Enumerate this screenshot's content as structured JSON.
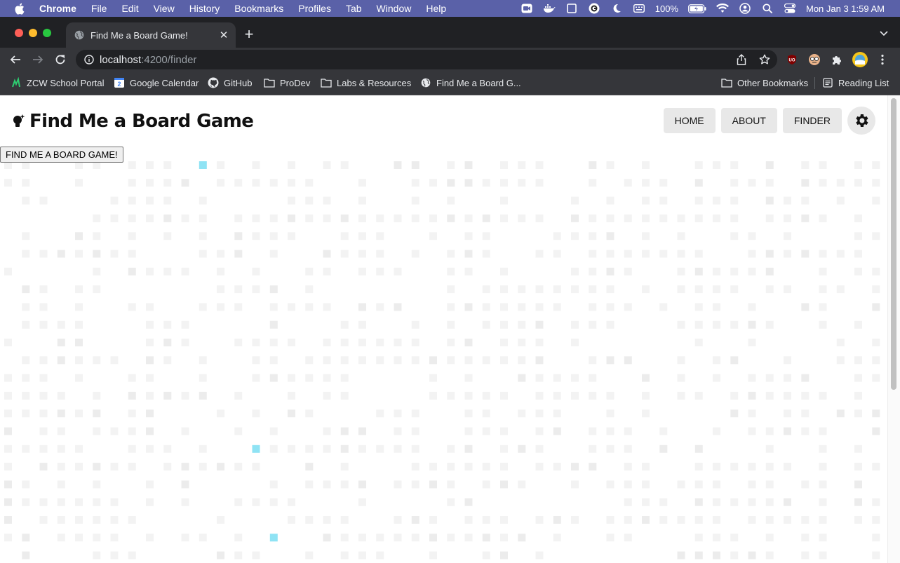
{
  "menubar": {
    "app": "Chrome",
    "items": [
      "File",
      "Edit",
      "View",
      "History",
      "Bookmarks",
      "Profiles",
      "Tab",
      "Window",
      "Help"
    ],
    "battery": "100%",
    "datetime": "Mon Jan 3  1:59 AM"
  },
  "browser": {
    "tab_title": "Find Me a Board Game!",
    "url_host": "localhost",
    "url_path": ":4200/finder",
    "bookmarks": [
      {
        "label": "ZCW School Portal",
        "icon": "zcw-icon"
      },
      {
        "label": "Google Calendar",
        "icon": "calendar-icon"
      },
      {
        "label": "GitHub",
        "icon": "github-icon"
      },
      {
        "label": "ProDev",
        "icon": "folder-icon"
      },
      {
        "label": "Labs & Resources",
        "icon": "folder-icon"
      },
      {
        "label": "Find Me a Board G...",
        "icon": "globe-icon"
      }
    ],
    "other_bookmarks": "Other Bookmarks",
    "reading_list": "Reading List"
  },
  "app": {
    "brand": "Find Me a Board Game",
    "nav": {
      "home": "HOME",
      "about": "ABOUT",
      "finder": "FINDER"
    },
    "find_button": "FIND ME A BOARD GAME!",
    "colors": {
      "tile": "#f3f3f3",
      "tile_dark": "#ececec",
      "highlight": "#8fe3f4"
    }
  }
}
